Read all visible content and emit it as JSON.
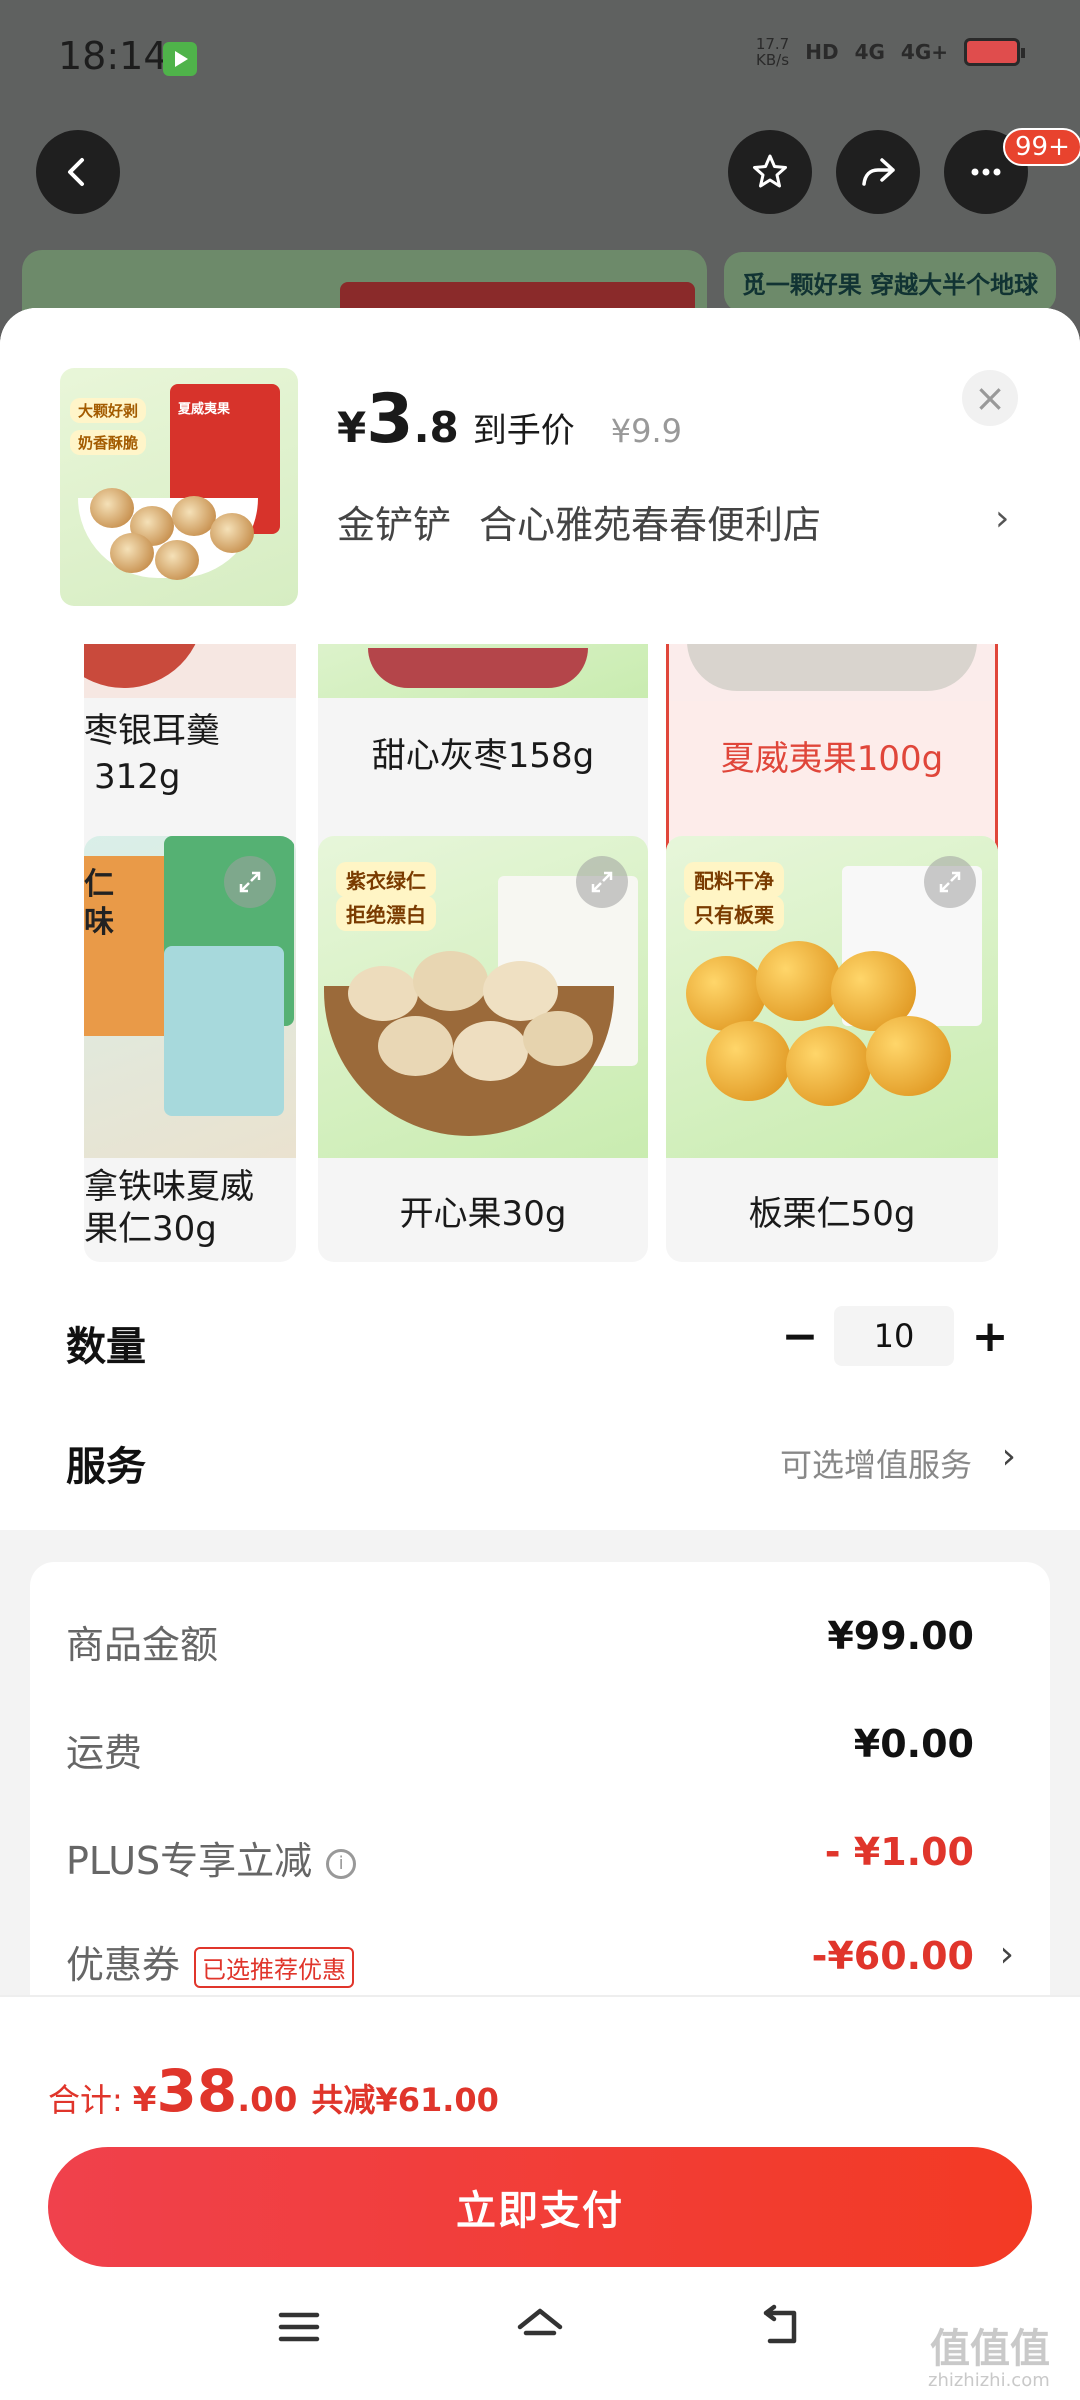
{
  "status_bar": {
    "time": "18:14",
    "net_speed_value": "17.7",
    "net_speed_unit": "KB/s",
    "chips": [
      "HD",
      "4G",
      "4G+"
    ]
  },
  "top_nav": {
    "more_badge": "99+",
    "banner_right": "觅一颗好果 穿越大半个地球"
  },
  "product": {
    "thumb_tags": [
      "大颗好剥",
      "奶香酥脆"
    ],
    "thumb_bag_text": "夏威夷果",
    "price_yen": "¥",
    "price_int": "3",
    "price_dec": ".8",
    "price_label": "到手价",
    "original_price": "¥9.9",
    "close": "×",
    "store_name": "金铲铲",
    "store_sub": "合心雅苑春春便利店",
    "chevron": "›"
  },
  "variants": [
    {
      "label": "枣银耳羹312g",
      "line1": "枣银耳羹",
      "line2": "312g",
      "selected": false
    },
    {
      "label": "甜心灰枣158g",
      "selected": false
    },
    {
      "label": "夏威夷果100g",
      "selected": true
    },
    {
      "label": "拿铁味夏威果仁30g",
      "line1": "拿铁味夏威",
      "line2": "果仁30g",
      "selected": false,
      "tags": [
        "仁",
        "味"
      ]
    },
    {
      "label": "开心果30g",
      "selected": false,
      "tags": [
        "紫衣绿仁",
        "拒绝漂白"
      ]
    },
    {
      "label": "板栗仁50g",
      "selected": false,
      "tags": [
        "配料干净",
        "只有板栗"
      ]
    }
  ],
  "quantity": {
    "title": "数量",
    "minus": "−",
    "value": "10",
    "plus": "+"
  },
  "service": {
    "title": "服务",
    "hint": "可选增值服务",
    "chevron": "›"
  },
  "summary": {
    "rows": [
      {
        "label": "商品金额",
        "value": "¥99.00"
      },
      {
        "label": "运费",
        "value": "¥0.00"
      },
      {
        "label": "PLUS专享立减",
        "value": "- ¥1.00"
      },
      {
        "label": "优惠券",
        "tag": "已选推荐优惠",
        "value": "-¥60.00"
      }
    ],
    "info": "i",
    "chevron": "›"
  },
  "footer": {
    "total_label": "合计:",
    "total_yen": "¥",
    "total_int": "38",
    "total_dec": ".00",
    "saving": "共减¥61.00",
    "pay_button": "立即支付"
  },
  "watermark": {
    "main": "值值值",
    "sub": "zhizhizhi.com"
  },
  "colors": {
    "accent": "#e0352b",
    "pay_start": "#f0414c",
    "pay_end": "#f33a24"
  }
}
